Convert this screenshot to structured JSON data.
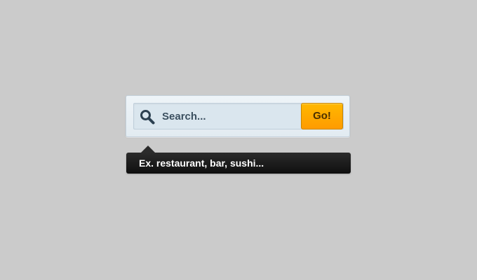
{
  "search": {
    "placeholder": "Search...",
    "value": "",
    "icon": "search-icon",
    "button_label": "Go!"
  },
  "tooltip": {
    "text": "Ex. restaurant, bar, sushi..."
  },
  "colors": {
    "background": "#cbcbcb",
    "panel": "#e6eef4",
    "field": "#dae6ee",
    "button": "#ffa800",
    "button_text": "#4a3000",
    "tooltip": "#1b1b1b",
    "tooltip_text": "#ffffff",
    "label_text": "#3c5060"
  }
}
